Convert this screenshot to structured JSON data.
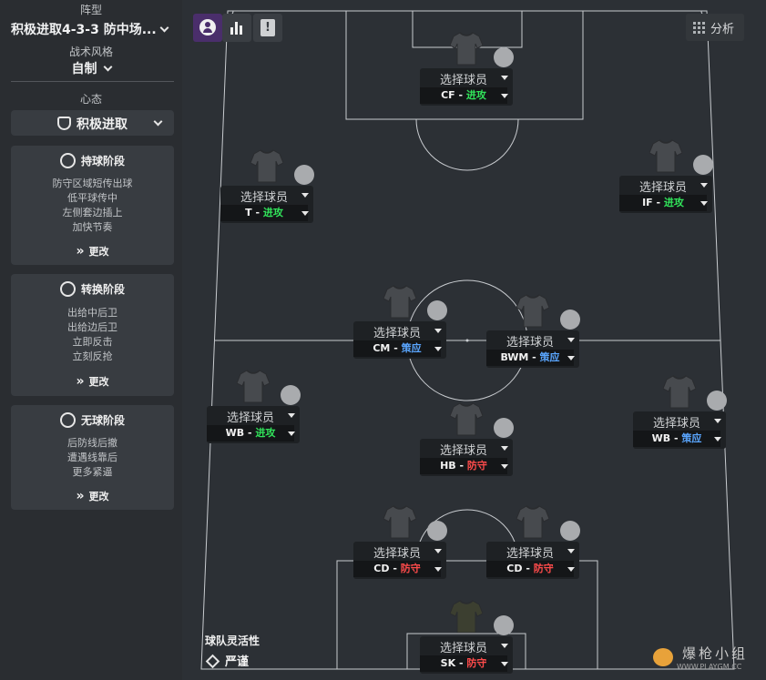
{
  "sidebar": {
    "formation_label": "阵型",
    "formation_value": "积极进取4-3-3 防中场...",
    "style_label": "战术风格",
    "style_value": "自制",
    "mentality_label": "心态",
    "mentality_value": "积极进取",
    "phases": [
      {
        "title": "持球阶段",
        "lines": [
          "防守区域短传出球",
          "低平球传中",
          "左侧套边插上",
          "加快节奏"
        ],
        "change": "更改"
      },
      {
        "title": "转换阶段",
        "lines": [
          "出给中后卫",
          "出给边后卫",
          "立即反击",
          "立刻反抢"
        ],
        "change": "更改"
      },
      {
        "title": "无球阶段",
        "lines": [
          "后防线后撤",
          "遭遇线靠后",
          "更多紧逼"
        ],
        "change": "更改"
      }
    ]
  },
  "toolbar": {
    "analysis_label": "分析",
    "icons": [
      "player-icon",
      "bar-chart-icon",
      "alert-icon",
      "grid-icon"
    ]
  },
  "players": [
    {
      "id": "cf",
      "select": "选择球员",
      "role": "CF",
      "duty": "进攻",
      "duty_type": "att"
    },
    {
      "id": "t",
      "select": "选择球员",
      "role": "T",
      "duty": "进攻",
      "duty_type": "att"
    },
    {
      "id": "if",
      "select": "选择球员",
      "role": "IF",
      "duty": "进攻",
      "duty_type": "att"
    },
    {
      "id": "cm",
      "select": "选择球员",
      "role": "CM",
      "duty": "策应",
      "duty_type": "sup"
    },
    {
      "id": "bwm",
      "select": "选择球员",
      "role": "BWM",
      "duty": "策应",
      "duty_type": "sup"
    },
    {
      "id": "wbl",
      "select": "选择球员",
      "role": "WB",
      "duty": "进攻",
      "duty_type": "att"
    },
    {
      "id": "hb",
      "select": "选择球员",
      "role": "HB",
      "duty": "防守",
      "duty_type": "def"
    },
    {
      "id": "wbr",
      "select": "选择球员",
      "role": "WB",
      "duty": "策应",
      "duty_type": "sup"
    },
    {
      "id": "cdl",
      "select": "选择球员",
      "role": "CD",
      "duty": "防守",
      "duty_type": "def"
    },
    {
      "id": "cdr",
      "select": "选择球员",
      "role": "CD",
      "duty": "防守",
      "duty_type": "def"
    },
    {
      "id": "sk",
      "select": "选择球员",
      "role": "SK",
      "duty": "防守",
      "duty_type": "def"
    }
  ],
  "fluidity": {
    "label": "球队灵活性",
    "value": "严谨"
  },
  "watermark": {
    "text": "爆枪小组",
    "sub": "WWW.PLAYGM.CC"
  },
  "colors": {
    "attack": "#31e35a",
    "support": "#5aa6ff",
    "defend": "#ff4b4b"
  }
}
